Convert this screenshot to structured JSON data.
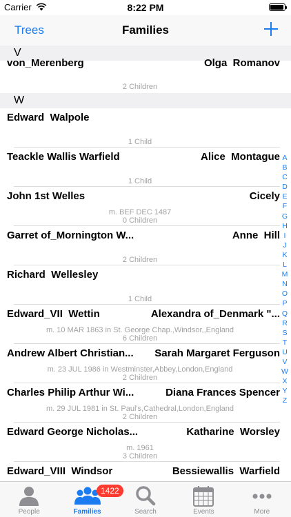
{
  "status": {
    "carrier": "Carrier",
    "time": "8:22 PM"
  },
  "nav": {
    "back_label": "Trees",
    "title": "Families"
  },
  "sections": {
    "v": "V",
    "w": "W"
  },
  "partial_row": {
    "husband": "von_Merenberg",
    "wife": "Olga  Romanov"
  },
  "families": [
    {
      "husband": "",
      "wife": "",
      "marriage": "",
      "children": "2 Children"
    },
    {
      "husband": "Edward  Walpole",
      "wife": "",
      "marriage": "",
      "children": "1 Child"
    },
    {
      "husband": "Teackle Wallis Warfield",
      "wife": "Alice  Montague",
      "marriage": "",
      "children": "1 Child"
    },
    {
      "husband": "John 1st Welles",
      "wife": "Cicely",
      "marriage": "m. BEF DEC 1487",
      "children": "0 Children"
    },
    {
      "husband": "Garret of_Mornington W...",
      "wife": "Anne  Hill",
      "marriage": "",
      "children": "2 Children"
    },
    {
      "husband": "Richard  Wellesley",
      "wife": "",
      "marriage": "",
      "children": "1 Child"
    },
    {
      "husband": "Edward_VII  Wettin",
      "wife": "Alexandra of_Denmark \"...",
      "marriage": "m. 10 MAR 1863 in St. George Chap.,Windsor,,England",
      "children": "6 Children"
    },
    {
      "husband": "Andrew Albert Christian...",
      "wife": "Sarah Margaret Ferguson",
      "marriage": "m. 23 JUL 1986 in Westminster,Abbey,London,England",
      "children": "2 Children"
    },
    {
      "husband": "Charles Philip Arthur Wi...",
      "wife": "Diana Frances Spencer",
      "marriage": "m. 29 JUL 1981 in St. Paul's,Cathedral,London,England",
      "children": "2 Children"
    },
    {
      "husband": "Edward George Nicholas...",
      "wife": "Katharine  Worsley",
      "marriage": "m. 1961",
      "children": "3 Children"
    },
    {
      "husband": "Edward_VIII  Windsor",
      "wife": "Bessiewallis  Warfield",
      "marriage": "",
      "children": ""
    }
  ],
  "index_letters": [
    "A",
    "B",
    "C",
    "D",
    "E",
    "F",
    "G",
    "H",
    "I",
    "J",
    "K",
    "L",
    "M",
    "N",
    "O",
    "P",
    "Q",
    "R",
    "S",
    "T",
    "U",
    "V",
    "W",
    "X",
    "Y",
    "Z"
  ],
  "tabs": [
    {
      "label": "People",
      "icon": "person-icon"
    },
    {
      "label": "Families",
      "icon": "family-icon",
      "badge": "1422"
    },
    {
      "label": "Search",
      "icon": "search-icon"
    },
    {
      "label": "Events",
      "icon": "calendar-icon"
    },
    {
      "label": "More",
      "icon": "more-icon"
    }
  ],
  "colors": {
    "accent": "#1a7cf0",
    "badge": "#fe3b30",
    "secondary_text": "#a2a2a2",
    "section_bg": "#f0f0f2"
  }
}
